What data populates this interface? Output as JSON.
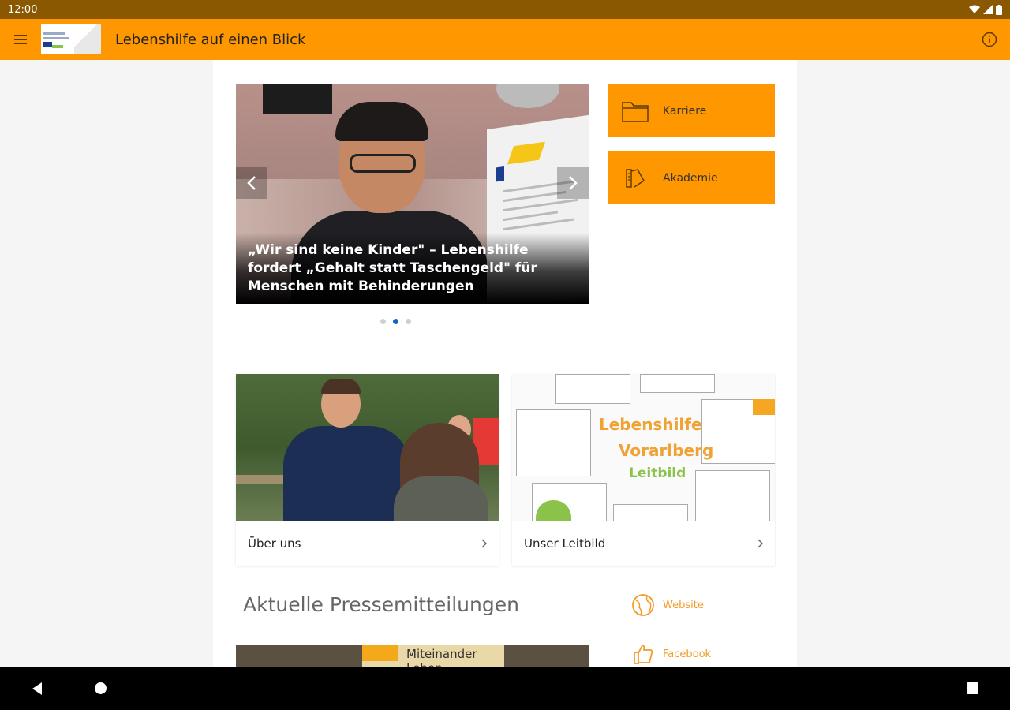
{
  "status_bar": {
    "time": "12:00",
    "icons": [
      "wifi-icon",
      "signal-icon",
      "battery-icon"
    ]
  },
  "app_bar": {
    "title": "Lebenshilfe auf einen Blick",
    "menu_icon": "menu-icon",
    "info_icon": "info-icon"
  },
  "carousel": {
    "caption": "„Wir sind keine Kinder\" – Lebenshilfe fordert „Gehalt statt Taschengeld\" für Menschen mit Behinderungen",
    "dots": 3,
    "active_dot": 1
  },
  "tiles": [
    {
      "label": "Karriere",
      "icon": "folder-icon"
    },
    {
      "label": "Akademie",
      "icon": "academy-icon"
    }
  ],
  "cards": [
    {
      "label": "Über uns"
    },
    {
      "label": "Unser Leitbild"
    }
  ],
  "leitbild_image": {
    "line1": "Lebenshilfe",
    "line2": "Vorarlberg",
    "line3": "Leitbild"
  },
  "press": {
    "title": "Aktuelle Pressemitteilungen",
    "image_sign": "Miteinander Leben"
  },
  "social": [
    {
      "label": "Website",
      "icon": "globe-icon"
    },
    {
      "label": "Facebook",
      "icon": "thumbs-up-icon"
    }
  ],
  "colors": {
    "accent": "#ff9800",
    "status_bar": "#8a5800",
    "link": "#f39c2b",
    "dot_active": "#1565c0"
  }
}
